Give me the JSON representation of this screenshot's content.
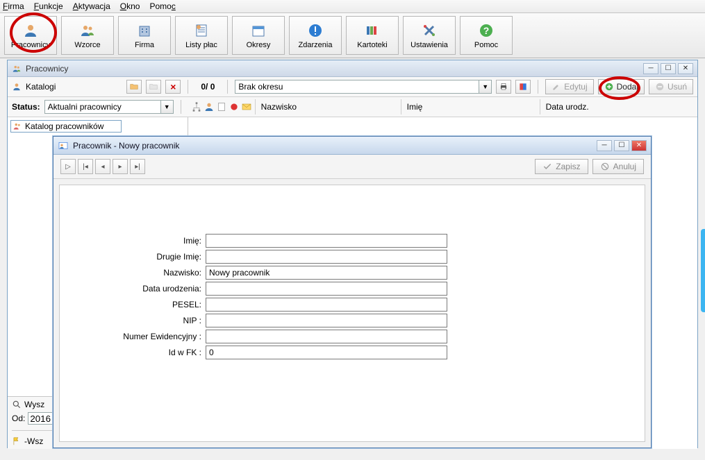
{
  "menu": [
    "Firma",
    "Funkcje",
    "Aktywacja",
    "Okno",
    "Pomoc"
  ],
  "menu_acc": [
    "F",
    "F",
    "A",
    "O",
    "P"
  ],
  "bigbar": [
    {
      "label": "Pracownicy",
      "icon": "person"
    },
    {
      "label": "Wzorce",
      "icon": "people"
    },
    {
      "label": "Firma",
      "icon": "building"
    },
    {
      "label": "Listy płac",
      "icon": "sheet"
    },
    {
      "label": "Okresy",
      "icon": "calendar"
    },
    {
      "label": "Zdarzenia",
      "icon": "alert"
    },
    {
      "label": "Kartoteki",
      "icon": "books"
    },
    {
      "label": "Ustawienia",
      "icon": "tools"
    },
    {
      "label": "Pomoc",
      "icon": "help"
    }
  ],
  "subwin_title": "Pracownicy",
  "katalogi": {
    "label": "Katalogi",
    "count": "0/ 0",
    "period": "Brak okresu",
    "edit": "Edytuj",
    "add": "Dodaj",
    "remove": "Usuń"
  },
  "status": {
    "label": "Status:",
    "value": "Aktualni pracownicy",
    "columns": [
      "Nazwisko",
      "Imię",
      "Data urodz."
    ]
  },
  "tree_root": "Katalog pracowników",
  "filter": {
    "wysz": "Wysz",
    "od": "Od:",
    "od_val": "2016",
    "wsz": "-Wsz"
  },
  "dialog": {
    "title": "Pracownik - Nowy pracownik",
    "save": "Zapisz",
    "cancel": "Anuluj",
    "fields": [
      {
        "label": "Imię:",
        "value": ""
      },
      {
        "label": "Drugie Imię:",
        "value": ""
      },
      {
        "label": "Nazwisko:",
        "value": "Nowy pracownik"
      },
      {
        "label": "Data urodzenia:",
        "value": ""
      },
      {
        "label": "PESEL:",
        "value": ""
      },
      {
        "label": "NIP :",
        "value": ""
      },
      {
        "label": "Numer Ewidencyjny :",
        "value": ""
      },
      {
        "label": "Id w FK :",
        "value": "0"
      }
    ]
  }
}
